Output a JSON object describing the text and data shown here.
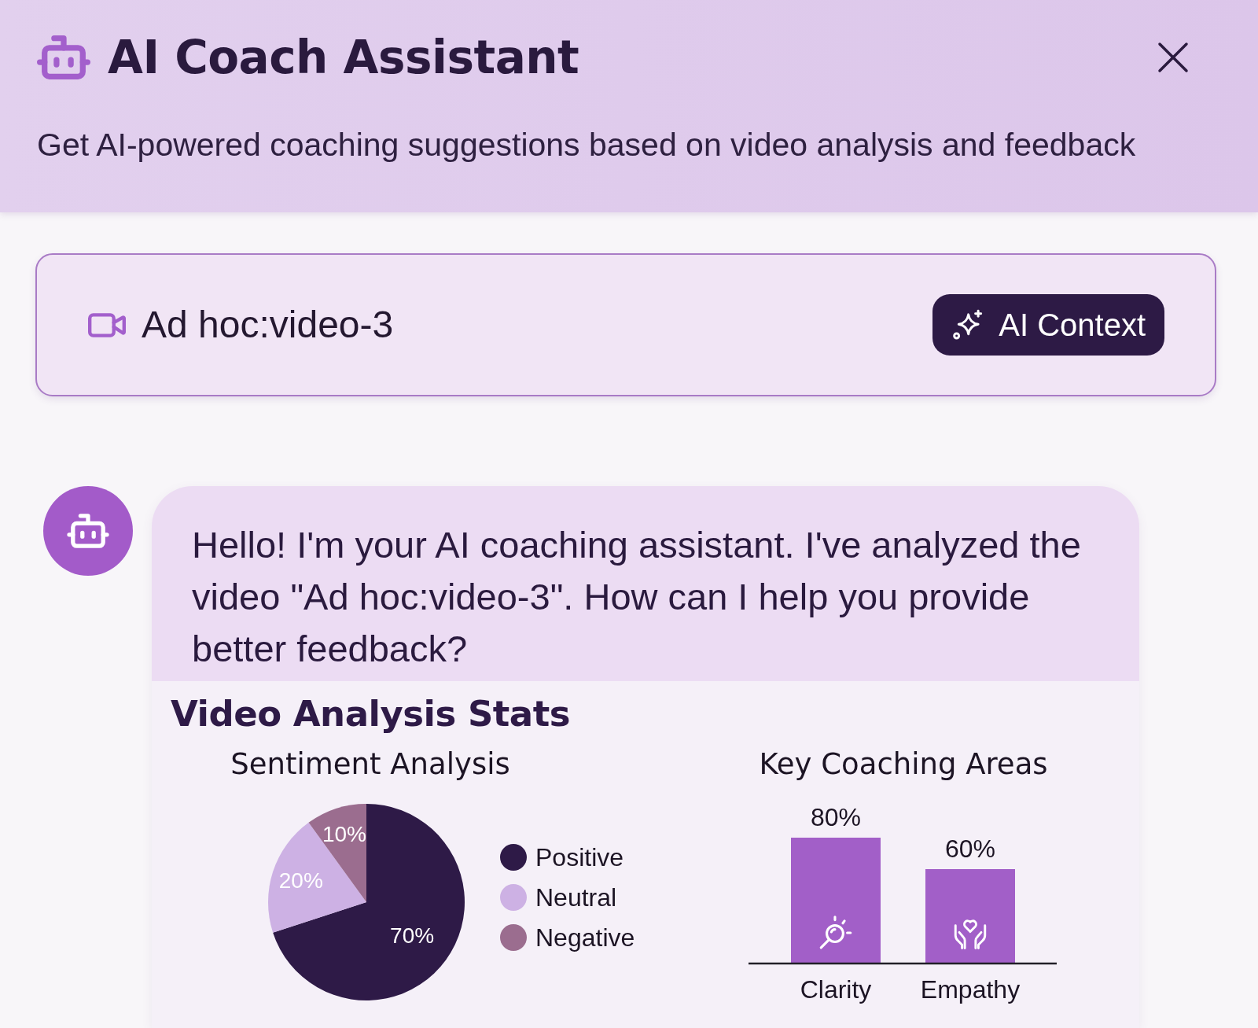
{
  "header": {
    "title": "AI Coach Assistant",
    "subtitle": "Get AI-powered coaching suggestions based on video analysis and feedback"
  },
  "context_card": {
    "video_title": "Ad hoc:video-3",
    "button": "AI Context"
  },
  "messages": [
    {
      "kind": "assistant",
      "text": "Hello! I'm your AI coaching assistant. I've analyzed the video \"Ad hoc:video-3\". How can I help you provide better feedback?",
      "stats": {
        "title": "Video Analysis Stats",
        "sentiment": {
          "chart_data": {
            "type": "pie",
            "title": "Sentiment Analysis",
            "categories": [
              "Positive",
              "Neutral",
              "Negative"
            ],
            "values": [
              70,
              20,
              10
            ],
            "colors": [
              "#2e1a47",
              "#cdb1e4",
              "#9b6d8f"
            ],
            "value_labels": [
              "70%",
              "20%",
              "10%"
            ],
            "legend": "right"
          }
        },
        "coaching_areas": {
          "chart_data": {
            "type": "bar",
            "title": "Key Coaching Areas",
            "categories": [
              "Clarity",
              "Empathy"
            ],
            "values": [
              80,
              60
            ],
            "value_labels": [
              "80%",
              "60%"
            ]
          }
        }
      }
    }
  ]
}
